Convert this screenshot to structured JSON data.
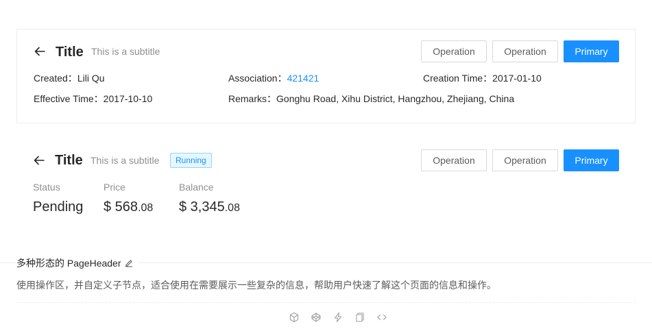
{
  "header_one": {
    "title": "Title",
    "subtitle": "This is a subtitle",
    "buttons": {
      "op1": "Operation",
      "op2": "Operation",
      "primary": "Primary"
    },
    "descriptions": {
      "created_label": "Created：",
      "created_value": "Lili Qu",
      "association_label": "Association：",
      "association_value": "421421",
      "creation_time_label": "Creation Time：",
      "creation_time_value": "2017-01-10",
      "effective_time_label": "Effective Time：",
      "effective_time_value": "2017-10-10",
      "remarks_label": "Remarks：",
      "remarks_value": "Gonghu Road, Xihu District, Hangzhou, Zhejiang, China"
    }
  },
  "header_two": {
    "title": "Title",
    "subtitle": "This is a subtitle",
    "tag": "Running",
    "buttons": {
      "op1": "Operation",
      "op2": "Operation",
      "primary": "Primary"
    },
    "stats": {
      "status_label": "Status",
      "status_value": "Pending",
      "price_label": "Price",
      "price_main": "$ 568",
      "price_decimal": ".08",
      "balance_label": "Balance",
      "balance_main": "$ 3,345",
      "balance_decimal": ".08"
    }
  },
  "demo": {
    "title": "多种形态的 PageHeader",
    "description": "使用操作区，并自定义子节点，适合使用在需要展示一些复杂的信息，帮助用户快速了解这个页面的信息和操作。"
  },
  "colors": {
    "primary": "#1890ff",
    "border": "#ebedf0",
    "tag_bg": "#e6f7ff",
    "tag_border": "#91d5ff"
  },
  "icons": [
    "arrow-left-icon",
    "edit-icon",
    "codesandbox-icon",
    "codepen-icon",
    "thunderbolt-icon",
    "copy-icon",
    "code-icon"
  ]
}
